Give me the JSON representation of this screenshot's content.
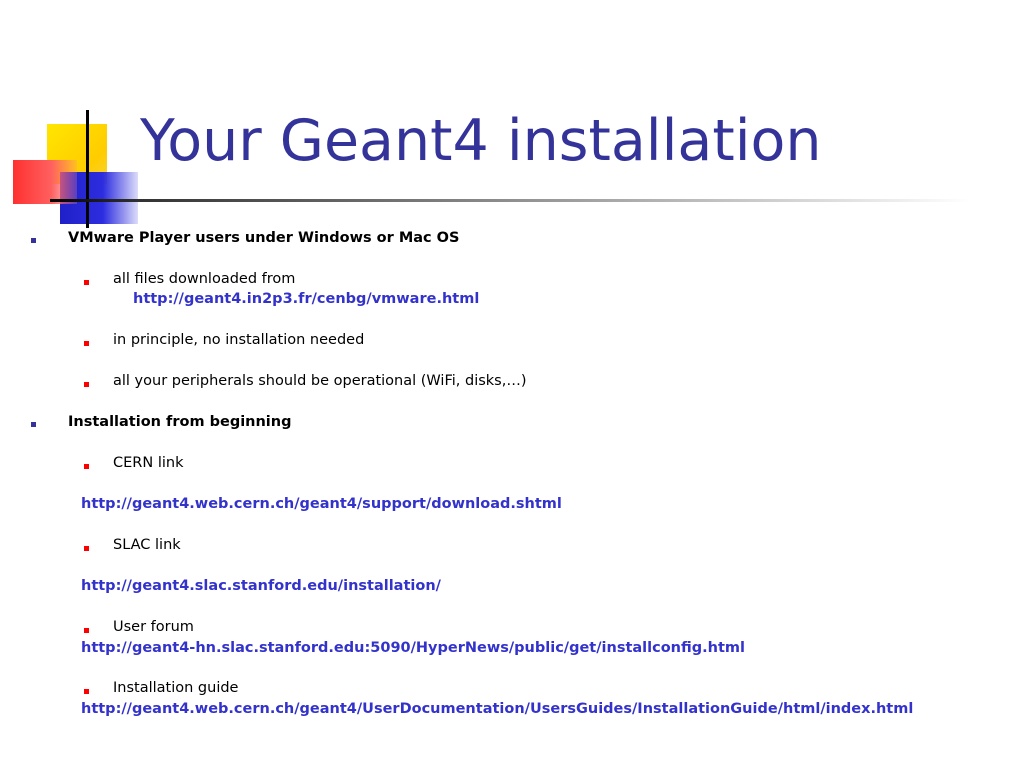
{
  "slide": {
    "title": "Your Geant4 installation",
    "sections": [
      {
        "heading": "VMware Player users under Windows or Mac OS",
        "items": [
          {
            "text": "all files downloaded from",
            "link": "http://geant4.in2p3.fr/cenbg/vmware.html"
          },
          {
            "text": "in principle, no installation needed"
          },
          {
            "text": "all your peripherals should be operational (WiFi, disks,…)"
          }
        ]
      },
      {
        "heading": "Installation from beginning",
        "items": [
          {
            "text": "CERN link",
            "link": "http://geant4.web.cern.ch/geant4/support/download.shtml"
          },
          {
            "text": "SLAC link",
            "link": "http://geant4.slac.stanford.edu/installation/"
          },
          {
            "text": "User forum",
            "link": "http://geant4-hn.slac.stanford.edu:5090/HyperNews/public/get/installconfig.html"
          },
          {
            "text": "Installation guide",
            "link": "http://geant4.web.cern.ch/geant4/UserDocumentation/UsersGuides/InstallationGuide/html/index.html"
          }
        ]
      }
    ]
  },
  "colors": {
    "title": "#333399",
    "link": "#3333cc",
    "level1_bullet": "#333399",
    "level2_bullet": "#ff0000",
    "body_text": "#000000"
  }
}
